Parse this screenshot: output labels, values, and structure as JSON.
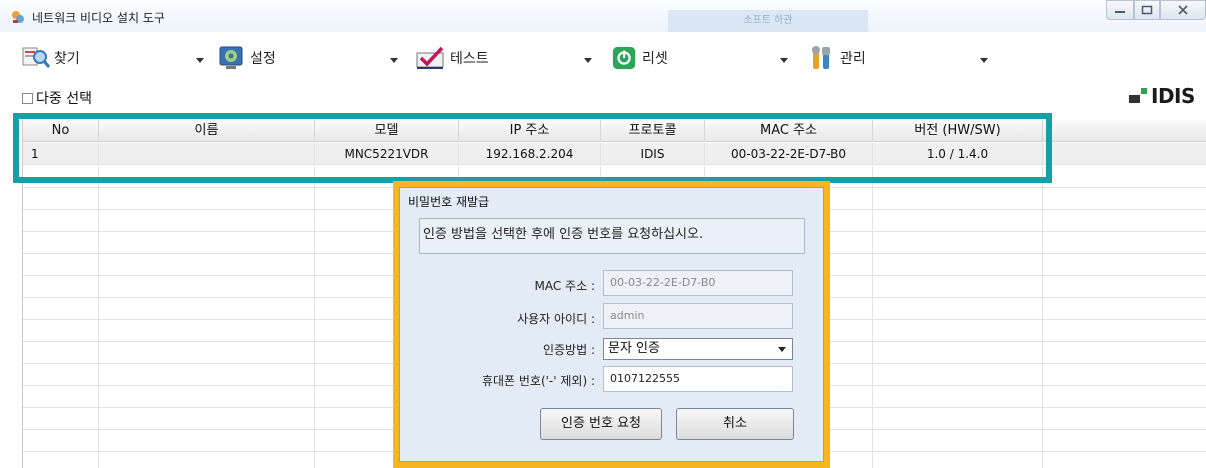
{
  "window": {
    "title": "네트워크 비디오 설치 도구",
    "ghost_tab": "소프트 하관"
  },
  "toolbar": {
    "items": [
      {
        "label": "찾기",
        "icon": "search-icon"
      },
      {
        "label": "설정",
        "icon": "settings-icon"
      },
      {
        "label": "테스트",
        "icon": "check-icon"
      },
      {
        "label": "리셋",
        "icon": "power-icon"
      },
      {
        "label": "관리",
        "icon": "tools-icon"
      }
    ],
    "multi_select": "다중 선택",
    "brand": "IDIS"
  },
  "table": {
    "columns": [
      "No",
      "이름",
      "모델",
      "IP 주소",
      "프로토콜",
      "MAC 주소",
      "버전 (HW/SW)"
    ],
    "rows": [
      [
        "1",
        "",
        "MNC5221VDR",
        "192.168.2.204",
        "IDIS",
        "00-03-22-2E-D7-B0",
        "1.0 / 1.4.0"
      ]
    ]
  },
  "dialog": {
    "title": "비밀번호 재발급",
    "message": "인증 방법을 선택한 후에 인증 번호를 요청하십시오.",
    "mac_label": "MAC 주소 :",
    "mac_value": "00-03-22-2E-D7-B0",
    "user_label": "사용자 아이디 :",
    "user_value": "admin",
    "method_label": "인증방법 :",
    "method_value": "문자 인증",
    "phone_label": "휴대폰 번호('-' 제외) :",
    "phone_value": "0107122555",
    "request_button": "인증 번호 요청",
    "cancel_button": "취소"
  },
  "colors": {
    "highlight_table": "#13a0a6",
    "highlight_dialog": "#f5b620"
  }
}
